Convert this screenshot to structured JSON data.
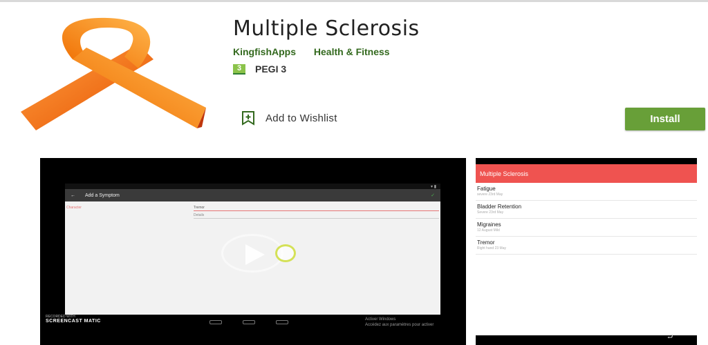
{
  "app": {
    "title": "Multiple Sclerosis",
    "developer": "KingfishApps",
    "category": "Health & Fitness",
    "rating_badge": "3",
    "rating_label": "PEGI 3",
    "wishlist_label": "Add to Wishlist",
    "install_label": "Install",
    "ribbon_color": "#f57c00",
    "accent_color": "#689f38"
  },
  "video": {
    "toolbar_title": "Add a Symptom",
    "field_label": "Character",
    "field_value": "Tremor",
    "field_placeholder": "Details",
    "watermark_small": "RECORDED WITH",
    "watermark": "SCREENCAST MATIC",
    "activate_line1": "Activer Windows",
    "activate_line2": "Accédez aux paramètres pour activer"
  },
  "phone": {
    "app_title": "Multiple Sclerosis",
    "items": [
      {
        "title": "Fatigue",
        "sub": "severe 23rd May"
      },
      {
        "title": "Bladder Retention",
        "sub": "Severe 23rd May"
      },
      {
        "title": "Migraines",
        "sub": "12 August  Mild"
      },
      {
        "title": "Tremor",
        "sub": "Right hand 23 May"
      }
    ]
  }
}
